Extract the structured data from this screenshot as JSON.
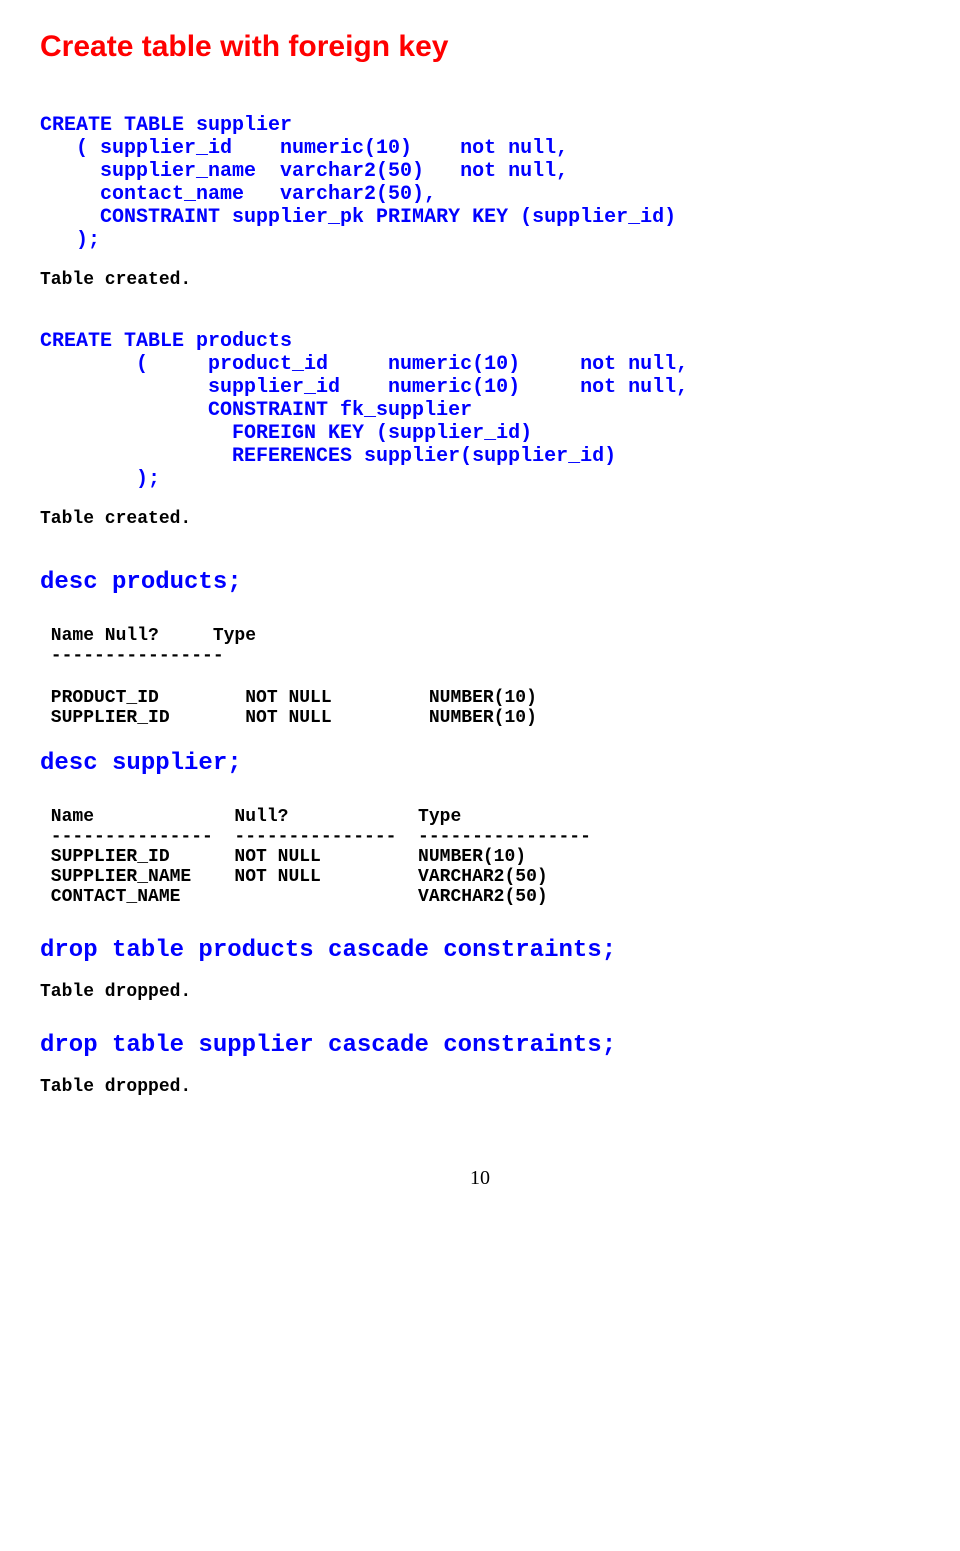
{
  "heading": "Create table with foreign key",
  "code1": "CREATE TABLE supplier\n   ( supplier_id    numeric(10)    not null,\n     supplier_name  varchar2(50)   not null,\n     contact_name   varchar2(50),\n     CONSTRAINT supplier_pk PRIMARY KEY (supplier_id)\n   );",
  "status1": "Table created.",
  "code2": "CREATE TABLE products\n        (     product_id     numeric(10)     not null,\n              supplier_id    numeric(10)     not null,\n              CONSTRAINT fk_supplier\n                FOREIGN KEY (supplier_id)\n                REFERENCES supplier(supplier_id)\n        );",
  "status2": "Table created.",
  "cmd1": "desc products;",
  "table1_header": " Name Null?     Type",
  "table1_divider": " ----------------",
  "table1_rows": " PRODUCT_ID        NOT NULL         NUMBER(10)\n SUPPLIER_ID       NOT NULL         NUMBER(10)",
  "cmd2": "desc supplier;",
  "table2_header": " Name             Null?            Type",
  "table2_divider": " ---------------  ---------------  ----------------",
  "table2_rows": " SUPPLIER_ID      NOT NULL         NUMBER(10)\n SUPPLIER_NAME    NOT NULL         VARCHAR2(50)\n CONTACT_NAME                      VARCHAR2(50)",
  "cmd3": "drop table products cascade constraints;",
  "status3": "Table dropped.",
  "cmd4": "drop table supplier cascade constraints;",
  "status4": "Table dropped.",
  "page_number": "10"
}
